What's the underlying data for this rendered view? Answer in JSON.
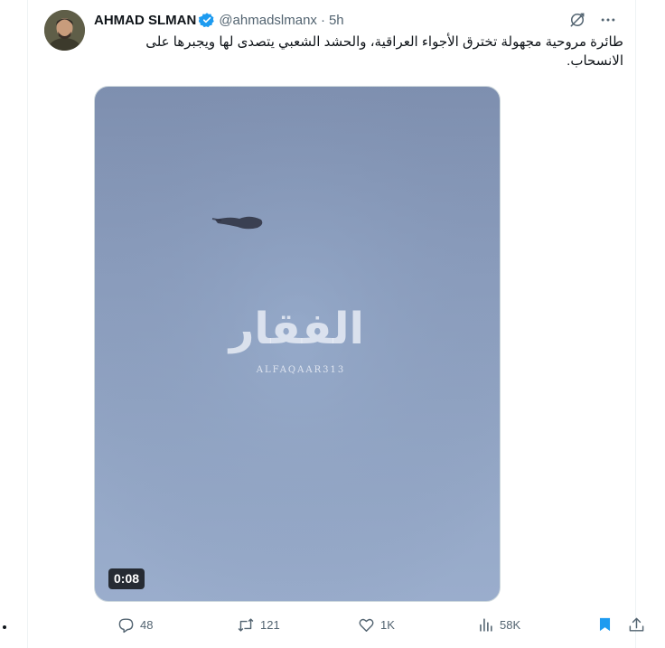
{
  "tweet": {
    "author_name": "AHMAD SLMAN",
    "handle": "@ahmadslmanx",
    "separator": "·",
    "time": "5h",
    "verified_icon": "verified-badge-icon",
    "text": "طائرة مروحية مجهولة تخترق الأجواء العراقية، والحشد الشعبي يتصدى لها ويجبرها على الانسحاب."
  },
  "media": {
    "type": "video",
    "watermark_arabic": "الفقار",
    "watermark_latin": "ALFAQAAR313",
    "duration": "0:08"
  },
  "actions": {
    "replies": "48",
    "reposts": "121",
    "likes": "1K",
    "views": "58K"
  },
  "colors": {
    "accent": "#1d9bf0",
    "muted": "#536471",
    "text": "#0f1419"
  },
  "icons": [
    "grok-icon",
    "more-icon",
    "reply-icon",
    "repost-icon",
    "like-icon",
    "views-icon",
    "bookmark-icon",
    "share-icon"
  ]
}
